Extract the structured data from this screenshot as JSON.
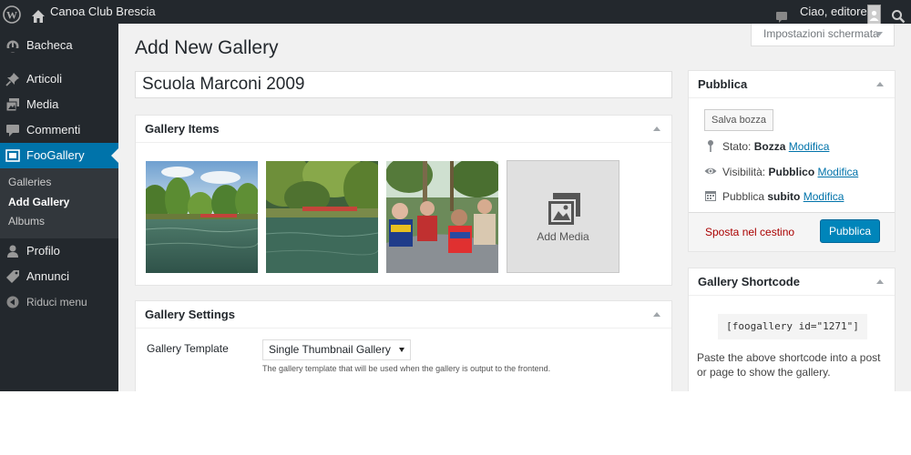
{
  "adminbar": {
    "site_name": "Canoa Club Brescia",
    "greeting": "Ciao, editore1"
  },
  "sidebar": {
    "items": [
      {
        "label": "Bacheca",
        "icon": "dashboard-icon"
      },
      {
        "label": "Articoli",
        "icon": "pushpin-icon"
      },
      {
        "label": "Media",
        "icon": "media-icon"
      },
      {
        "label": "Commenti",
        "icon": "comment-icon"
      },
      {
        "label": "FooGallery",
        "icon": "gallery-icon"
      },
      {
        "label": "Profilo",
        "icon": "user-icon"
      },
      {
        "label": "Annunci",
        "icon": "tag-icon"
      },
      {
        "label": "Riduci menu",
        "icon": "collapse-icon"
      }
    ],
    "submenu": [
      "Galleries",
      "Add Gallery",
      "Albums"
    ]
  },
  "page": {
    "title": "Add New Gallery",
    "screen_options": "Impostazioni schermata",
    "gallery_title_value": "Scuola Marconi 2009"
  },
  "gallery_items": {
    "heading": "Gallery Items",
    "add_media_label": "Add Media"
  },
  "gallery_settings": {
    "heading": "Gallery Settings",
    "template_label": "Gallery Template",
    "template_value": "Single Thumbnail Gallery",
    "template_description": "The gallery template that will be used when the gallery is output to the frontend."
  },
  "publish": {
    "heading": "Pubblica",
    "save_draft": "Salva bozza",
    "status_label": "Stato:",
    "status_value": "Bozza",
    "visibility_label": "Visibilità:",
    "visibility_value": "Pubblico",
    "publish_label": "Pubblica",
    "publish_value": "subito",
    "edit_link": "Modifica",
    "trash": "Sposta nel cestino",
    "publish_button": "Pubblica"
  },
  "shortcode": {
    "heading": "Gallery Shortcode",
    "code": "[foogallery id=\"1271\"]",
    "help": "Paste the above shortcode into a post or page to show the gallery."
  },
  "colors": {
    "adminbar_bg": "#23282d",
    "accent": "#0073aa",
    "primary_button": "#0085ba",
    "trash": "#aa0000"
  }
}
